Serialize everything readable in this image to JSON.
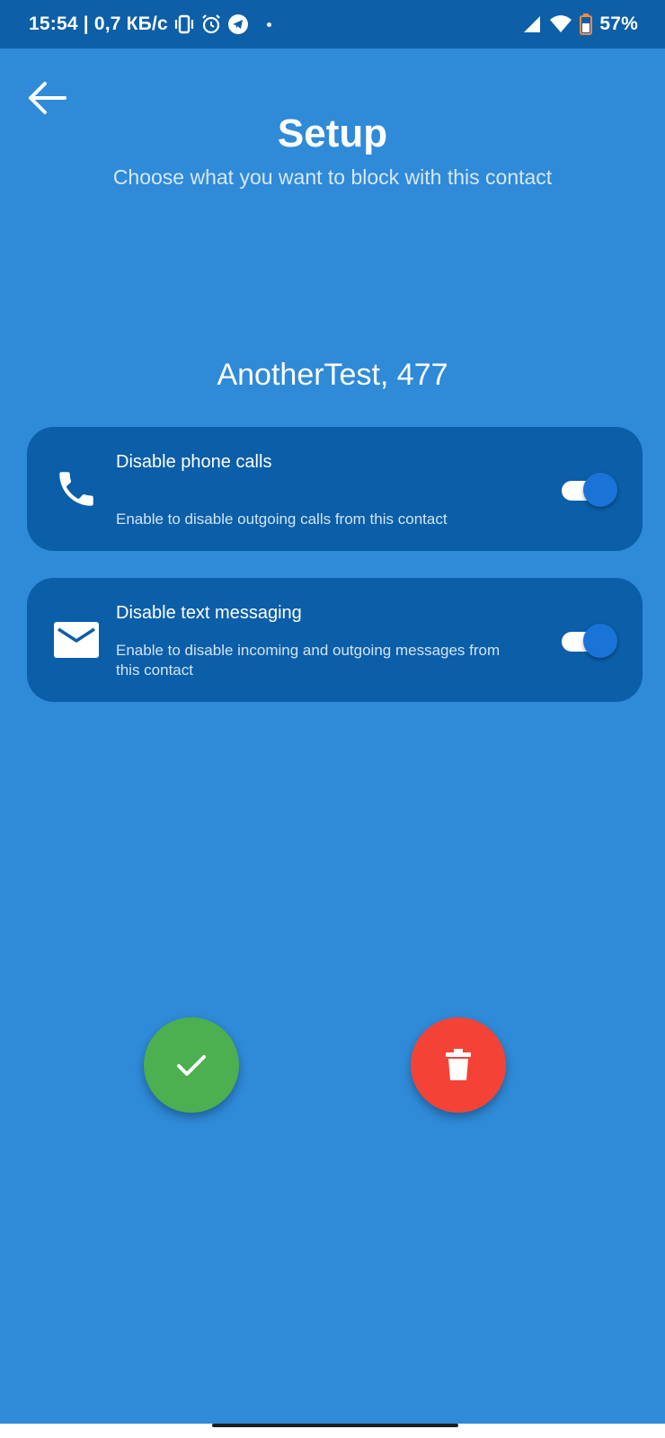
{
  "status_bar": {
    "time": "15:54",
    "network_speed": "| 0,7 КБ/с",
    "battery": "57%",
    "left_icons": [
      "vibrate-icon",
      "alarm-icon",
      "telegram-icon",
      "dot-icon"
    ],
    "right_icons": [
      "signal-icon",
      "wifi-icon",
      "battery-icon"
    ]
  },
  "header": {
    "title": "Setup",
    "subtitle": "Choose what you want to block with this contact"
  },
  "contact": {
    "name": "AnotherTest, 477"
  },
  "options": [
    {
      "icon": "phone-icon",
      "title": "Disable phone calls",
      "description": "Enable to disable outgoing calls from this contact",
      "enabled": true
    },
    {
      "icon": "envelope-icon",
      "title": "Disable text messaging",
      "description": "Enable to disable incoming and outgoing messages from this contact",
      "enabled": true
    }
  ],
  "actions": {
    "confirm_icon": "check-icon",
    "delete_icon": "trash-icon"
  },
  "colors": {
    "background": "#2f8ad8",
    "status_bar": "#0d5fa8",
    "card": "#0b5ea8",
    "toggle_thumb": "#1a73d6",
    "confirm": "#4caf50",
    "delete": "#f44336"
  }
}
